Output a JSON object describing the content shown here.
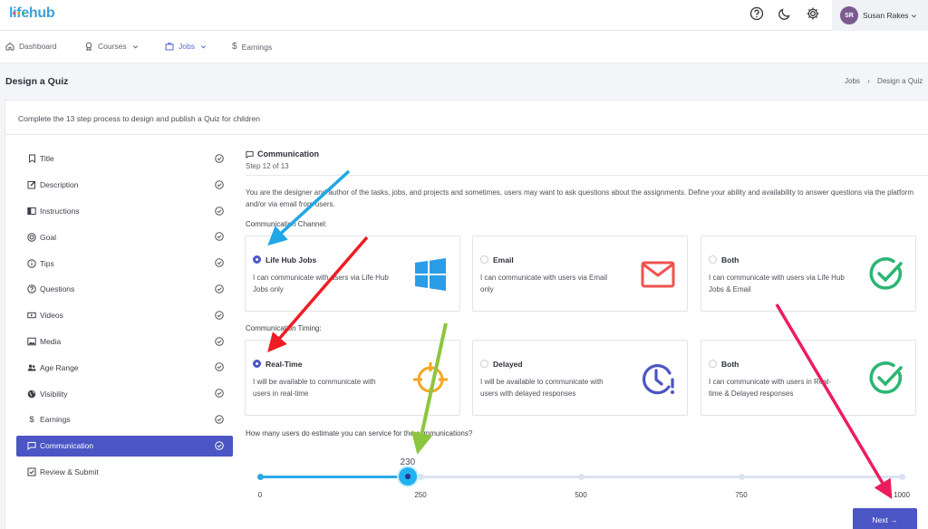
{
  "app": {
    "logo_text": "lifehub"
  },
  "user": {
    "initials": "SR",
    "name": "Susan Rakes"
  },
  "nav": {
    "items": [
      {
        "label": "Dashboard",
        "icon": "home-icon",
        "active": false
      },
      {
        "label": "Courses",
        "icon": "award-icon",
        "active": false,
        "dropdown": true
      },
      {
        "label": "Jobs",
        "icon": "briefcase-icon",
        "active": true,
        "dropdown": true
      },
      {
        "label": "Earnings",
        "icon": "dollar-icon",
        "active": false
      }
    ]
  },
  "page": {
    "title": "Design a Quiz",
    "breadcrumb": [
      "Jobs",
      "›",
      "Design a Quiz"
    ],
    "intro": "Complete the 13 step process to design and publish a Quiz for children"
  },
  "steps": [
    {
      "label": "Title",
      "icon": "bookmark-icon",
      "active": false
    },
    {
      "label": "Description",
      "icon": "edit-icon",
      "active": false
    },
    {
      "label": "Instructions",
      "icon": "book-icon",
      "active": false
    },
    {
      "label": "Goal",
      "icon": "target-icon",
      "active": false
    },
    {
      "label": "Tips",
      "icon": "info-icon",
      "active": false
    },
    {
      "label": "Questions",
      "icon": "help-icon",
      "active": false
    },
    {
      "label": "Videos",
      "icon": "video-icon",
      "active": false
    },
    {
      "label": "Media",
      "icon": "image-icon",
      "active": false
    },
    {
      "label": "Age Range",
      "icon": "users-icon",
      "active": false
    },
    {
      "label": "Visibility",
      "icon": "globe-icon",
      "active": false
    },
    {
      "label": "Earnings",
      "icon": "dollar-icon",
      "active": false
    },
    {
      "label": "Communication",
      "icon": "message-icon",
      "active": true
    },
    {
      "label": "Review & Submit",
      "icon": "check-square-icon",
      "active": false
    }
  ],
  "section": {
    "title": "Communication",
    "subtitle": "Step 12 of 13",
    "description": "You are the designer and author of the tasks, jobs, and projects and sometimes, users may want to ask questions about the assignments. Define your ability and availability to answer questions via the platform and/or via email from users.",
    "channel_label": "Communication Channel:",
    "timing_label": "Communication Timing:",
    "question": "How many users do estimate you can service for the communications?"
  },
  "channel_options": [
    {
      "title": "Life Hub Jobs",
      "desc": "I can communicate with users via Life Hub Jobs only",
      "selected": true,
      "icon": "windows-icon",
      "color": "#2a9de8"
    },
    {
      "title": "Email",
      "desc": "I can communicate with users via Email only",
      "selected": false,
      "icon": "mail-icon",
      "color": "#ef5350"
    },
    {
      "title": "Both",
      "desc": "I can communicate with users via Life Hub Jobs & Email",
      "selected": false,
      "icon": "check-circle-icon",
      "color": "#2bb673"
    }
  ],
  "timing_options": [
    {
      "title": "Real-Time",
      "desc": "I will be available to communicate with users in real-time",
      "selected": true,
      "icon": "crosshair-icon",
      "color": "#f5a623"
    },
    {
      "title": "Delayed",
      "desc": "I will be available to communicate with users with delayed responses",
      "selected": false,
      "icon": "clock-alert-icon",
      "color": "#4b55c4"
    },
    {
      "title": "Both",
      "desc": "I can communicate with users in Real-time & Delayed responses",
      "selected": false,
      "icon": "check-circle-icon",
      "color": "#2bb673"
    }
  ],
  "slider": {
    "value": "230",
    "numeric_value": 230,
    "min": 0,
    "max": 1000,
    "ticks": [
      "0",
      "250",
      "500",
      "750",
      "1000"
    ]
  },
  "actions": {
    "next_label": "Next →"
  },
  "colors": {
    "accent": "#4b55c4",
    "slider": "#2ba9e8"
  }
}
